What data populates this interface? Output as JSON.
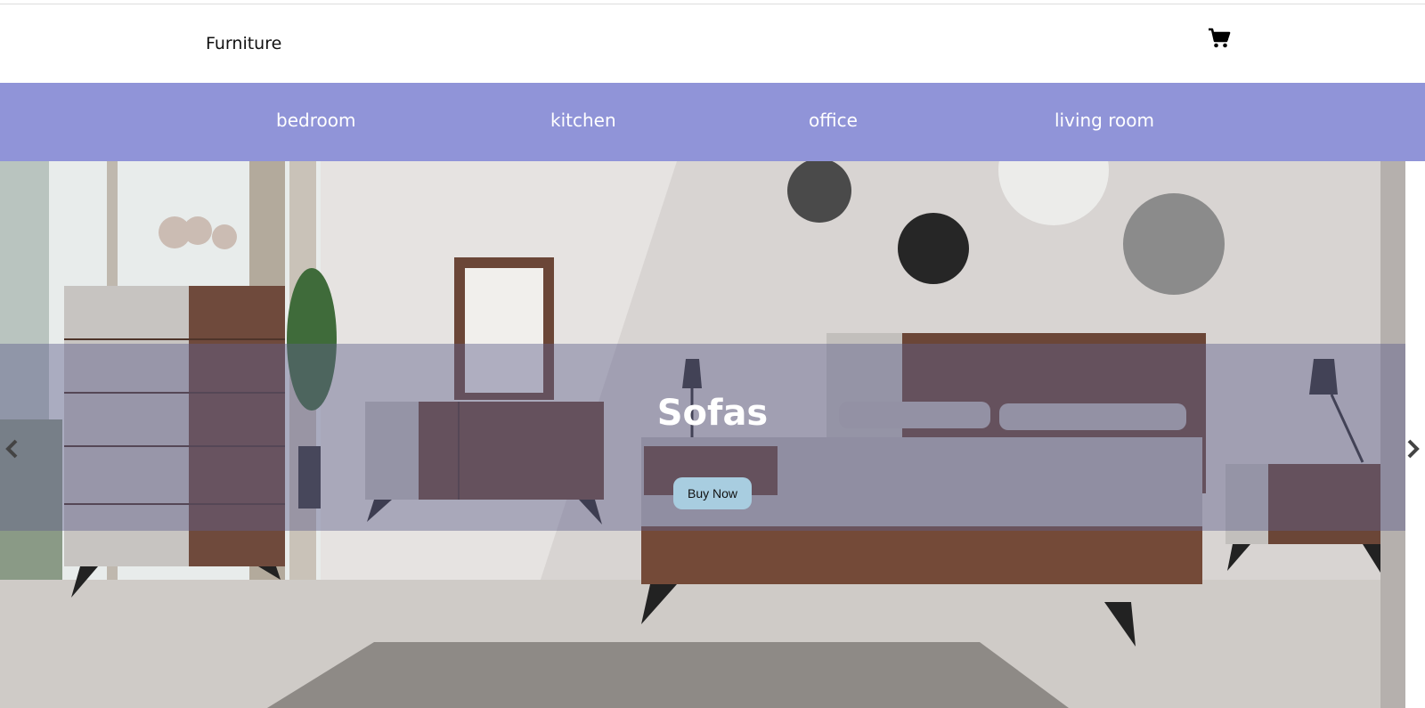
{
  "header": {
    "brand": "Furniture",
    "cart_icon": "shopping-cart-icon"
  },
  "nav": {
    "items": [
      {
        "label": "bedroom"
      },
      {
        "label": "kitchen"
      },
      {
        "label": "office"
      },
      {
        "label": "living room"
      }
    ]
  },
  "hero": {
    "title": "Sofas",
    "button_label": "Buy Now",
    "prev_icon": "chevron-left-icon",
    "next_icon": "chevron-right-icon",
    "image": "bedroom-furniture-photo"
  },
  "colors": {
    "nav_bg": "#9094d8",
    "button_bg": "#a8cde0",
    "overlay": "rgba(95,95,140,0.45)"
  }
}
